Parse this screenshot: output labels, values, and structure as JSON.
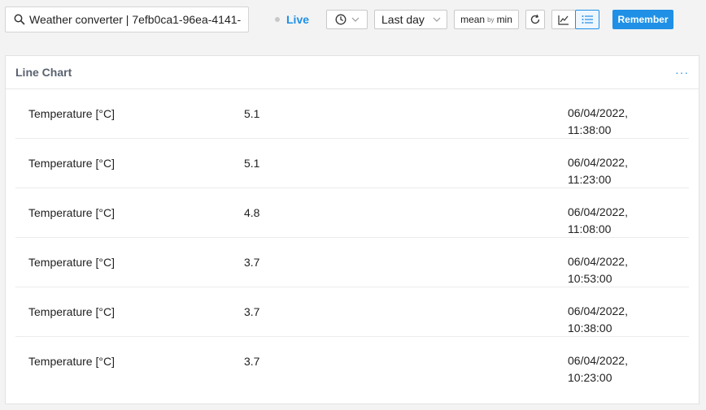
{
  "search": {
    "value": "Weather converter | 7efb0ca1-96ea-4141-",
    "icon": "search-icon"
  },
  "live": {
    "label": "Live",
    "color": "#1f90e6"
  },
  "toolbar": {
    "time_range_label": "Last day",
    "aggregation": {
      "function": "mean",
      "by": "by",
      "interval": "min"
    },
    "remember_label": "Remember",
    "accent": "#1f90e6"
  },
  "panel": {
    "title": "Line Chart",
    "menu_label": "···",
    "rows": [
      {
        "name": "Temperature [°C]",
        "value": "5.1",
        "time": "06/04/2022, 11:38:00"
      },
      {
        "name": "Temperature [°C]",
        "value": "5.1",
        "time": "06/04/2022, 11:23:00"
      },
      {
        "name": "Temperature [°C]",
        "value": "4.8",
        "time": "06/04/2022, 11:08:00"
      },
      {
        "name": "Temperature [°C]",
        "value": "3.7",
        "time": "06/04/2022, 10:53:00"
      },
      {
        "name": "Temperature [°C]",
        "value": "3.7",
        "time": "06/04/2022, 10:38:00"
      },
      {
        "name": "Temperature [°C]",
        "value": "3.7",
        "time": "06/04/2022, 10:23:00"
      }
    ]
  }
}
